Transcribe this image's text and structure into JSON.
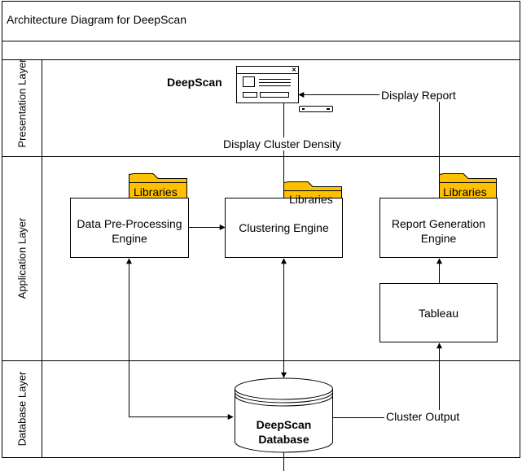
{
  "title": "Architecture Diagram for DeepScan",
  "lanes": {
    "presentation": "Presentation Layer",
    "application": "Application Layer",
    "database": "Database Layer"
  },
  "ui_label": "DeepScan",
  "nodes": {
    "preprocessing": "Data Pre-Processing Engine",
    "clustering": "Clustering Engine",
    "report": "Report Generation Engine",
    "tableau": "Tableau",
    "database": "DeepScan Database"
  },
  "libraries_label": "Libraries",
  "edges": {
    "display_report": "Display Report",
    "display_density": "Display Cluster Density",
    "cluster_output": "Cluster Output"
  },
  "colors": {
    "folder_fill": "#FFC000",
    "line": "#000000",
    "background": "#FFFFFF"
  },
  "icons": {
    "window": "window-mockup-icon",
    "server": "server-icon",
    "folder": "folder-icon"
  }
}
